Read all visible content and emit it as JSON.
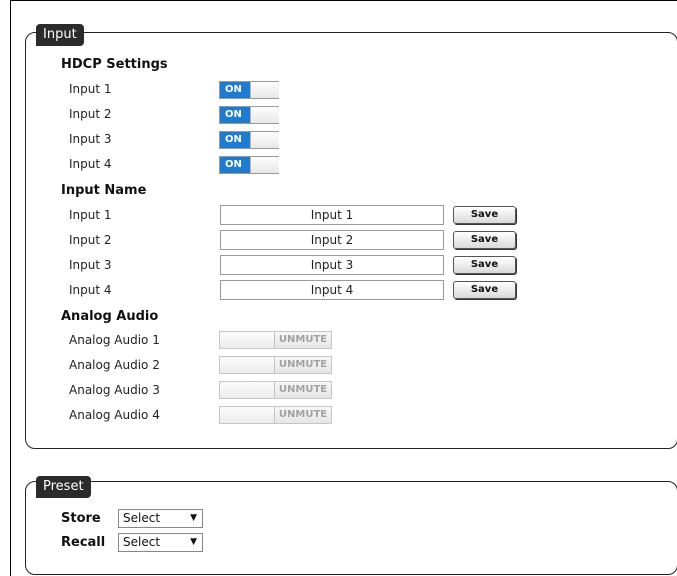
{
  "input_panel": {
    "legend": "Input",
    "hdcp": {
      "title": "HDCP Settings",
      "rows": [
        {
          "label": "Input 1",
          "state": "ON"
        },
        {
          "label": "Input 2",
          "state": "ON"
        },
        {
          "label": "Input 3",
          "state": "ON"
        },
        {
          "label": "Input 4",
          "state": "ON"
        }
      ]
    },
    "names": {
      "title": "Input Name",
      "save_label": "Save",
      "rows": [
        {
          "label": "Input 1",
          "value": "Input 1"
        },
        {
          "label": "Input 2",
          "value": "Input 2"
        },
        {
          "label": "Input 3",
          "value": "Input 3"
        },
        {
          "label": "Input 4",
          "value": "Input 4"
        }
      ]
    },
    "audio": {
      "title": "Analog Audio",
      "rows": [
        {
          "label": "Analog Audio 1",
          "state": "UNMUTE"
        },
        {
          "label": "Analog Audio 2",
          "state": "UNMUTE"
        },
        {
          "label": "Analog Audio 3",
          "state": "UNMUTE"
        },
        {
          "label": "Analog Audio 4",
          "state": "UNMUTE"
        }
      ]
    }
  },
  "preset_panel": {
    "legend": "Preset",
    "store": {
      "label": "Store",
      "selected": "Select"
    },
    "recall": {
      "label": "Recall",
      "selected": "Select"
    }
  },
  "colors": {
    "toggle_on": "#1e7bd0",
    "legend_bg": "#2b2b2b",
    "unmute_text": "#a2a2a2"
  }
}
